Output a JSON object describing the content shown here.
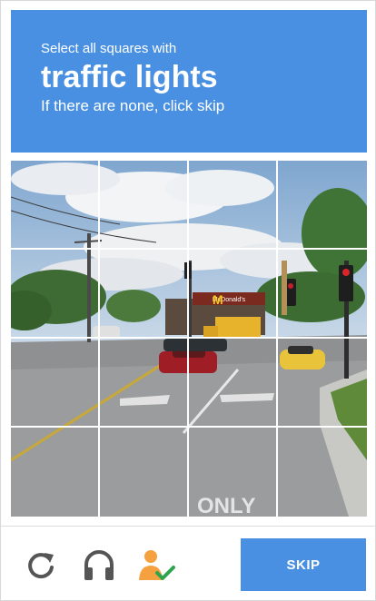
{
  "challenge": {
    "instruction": "Select all squares with",
    "keyword": "traffic lights",
    "hint": "If there are none, click skip"
  },
  "grid": {
    "tiles": 16,
    "scene_signage": "McDonald's",
    "road_marking": "ONLY"
  },
  "footer": {
    "reload_icon": "reload-icon",
    "audio_icon": "headphones-icon",
    "info_icon": "person-check-icon",
    "skip_label": "SKIP"
  },
  "colors": {
    "brand_blue": "#4a90e2",
    "icon_gray": "#555555",
    "person_orange": "#f5a13f",
    "check_green": "#2ea44f"
  }
}
